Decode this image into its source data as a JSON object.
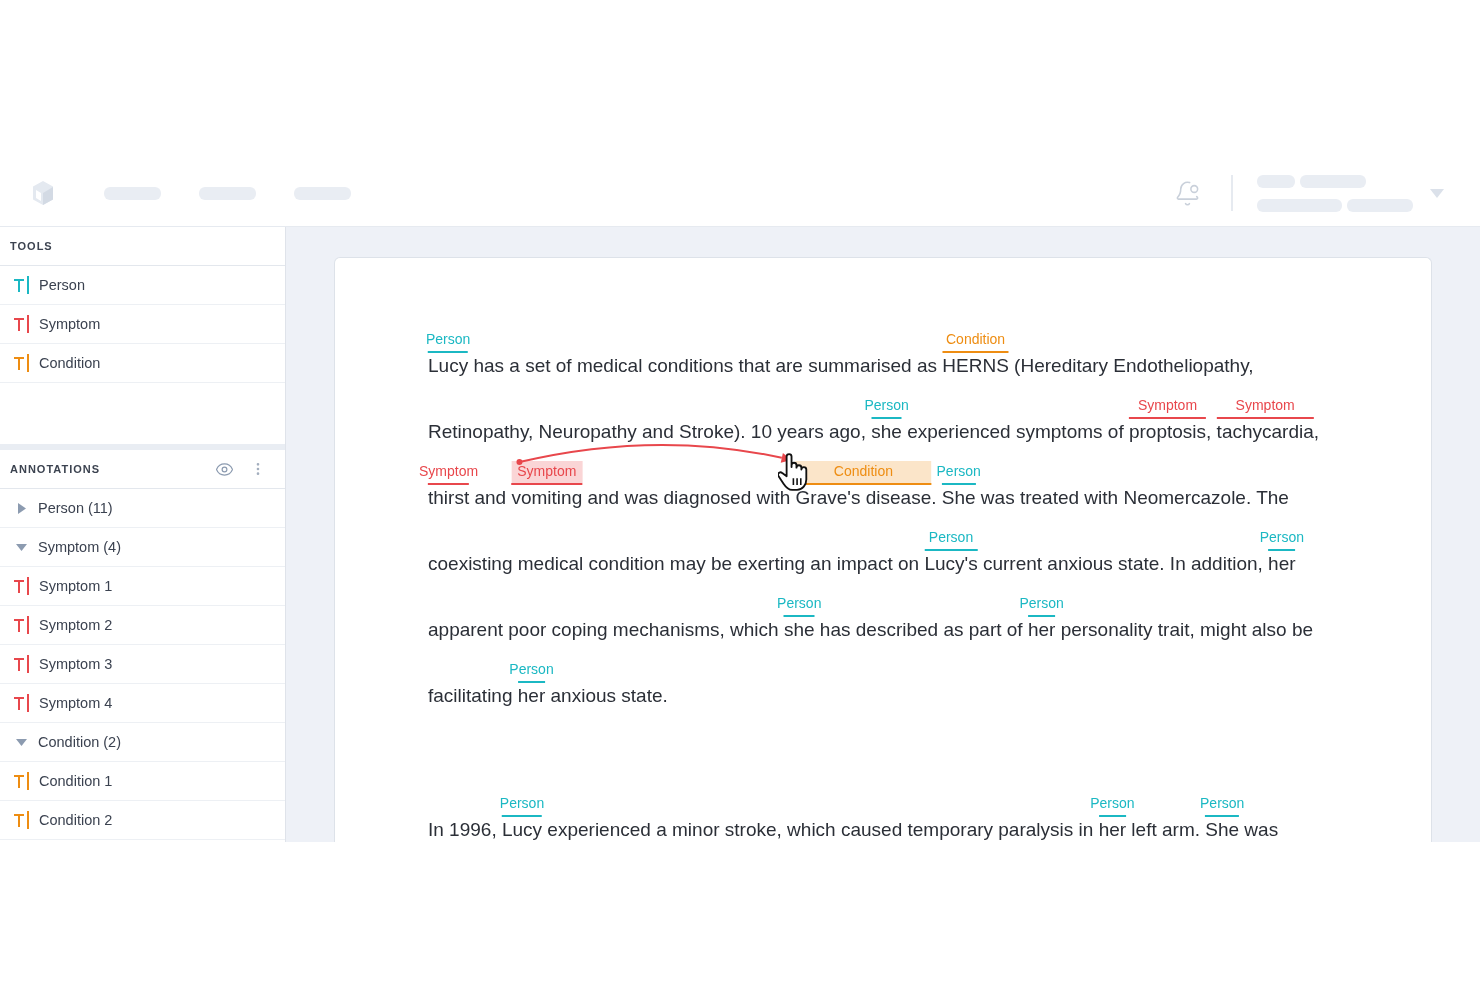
{
  "sidebar": {
    "tools": {
      "title": "TOOLS",
      "items": [
        {
          "label": "Person",
          "color": "#1bb8c3"
        },
        {
          "label": "Symptom",
          "color": "#e8474c"
        },
        {
          "label": "Condition",
          "color": "#ee8d12"
        }
      ]
    },
    "annotations": {
      "title": "ANNOTATIONS",
      "groups": [
        {
          "label": "Person (11)",
          "expanded": false
        },
        {
          "label": "Symptom (4)",
          "expanded": true,
          "children": [
            {
              "label": "Symptom 1",
              "color": "#e8474c"
            },
            {
              "label": "Symptom 2",
              "color": "#e8474c"
            },
            {
              "label": "Symptom 3",
              "color": "#e8474c"
            },
            {
              "label": "Symptom 4",
              "color": "#e8474c"
            }
          ]
        },
        {
          "label": "Condition (2)",
          "expanded": true,
          "children": [
            {
              "label": "Condition 1",
              "color": "#ee8d12"
            },
            {
              "label": "Condition 2",
              "color": "#ee8d12"
            }
          ]
        }
      ]
    }
  },
  "document": {
    "paragraphs": [
      {
        "lines": [
          {
            "segments": [
              {
                "text": "Lucy",
                "annotation": {
                  "label": "Person",
                  "color": "#1bb8c3",
                  "selected": false
                }
              },
              {
                "text": " has a set of medical conditions that are summarised as "
              },
              {
                "text": "HERNS",
                "annotation": {
                  "label": "Condition",
                  "color": "#ee8d12",
                  "selected": false
                }
              },
              {
                "text": " (Hereditary Endotheliopathy,"
              }
            ]
          },
          {
            "segments": [
              {
                "text": "Retinopathy, Neuropathy and Stroke). 10 years ago, "
              },
              {
                "text": "she",
                "annotation": {
                  "label": "Person",
                  "color": "#1bb8c3",
                  "selected": false
                }
              },
              {
                "text": " experienced symptoms of "
              },
              {
                "text": "proptosis",
                "annotation": {
                  "label": "Symptom",
                  "color": "#e8474c",
                  "selected": false
                }
              },
              {
                "text": ", "
              },
              {
                "text": "tachycardia",
                "annotation": {
                  "label": "Symptom",
                  "color": "#e8474c",
                  "selected": false
                }
              },
              {
                "text": ","
              }
            ]
          },
          {
            "segments": [
              {
                "text": "thirst",
                "annotation": {
                  "label": "Symptom",
                  "color": "#e8474c",
                  "selected": false
                }
              },
              {
                "text": " and "
              },
              {
                "text": "vomiting",
                "annotation": {
                  "label": "Symptom",
                  "color": "#e8474c",
                  "selected": true
                }
              },
              {
                "text": " and was diagnosed with "
              },
              {
                "text": "Grave's disease",
                "annotation": {
                  "label": "Condition",
                  "color": "#ee8d12",
                  "selected": true
                }
              },
              {
                "text": ". "
              },
              {
                "text": "She",
                "annotation": {
                  "label": "Person",
                  "color": "#1bb8c3",
                  "selected": false
                }
              },
              {
                "text": " was treated with Neomercazole. The"
              }
            ]
          },
          {
            "segments": [
              {
                "text": "coexisting medical condition may be exerting an impact on "
              },
              {
                "text": "Lucy's",
                "annotation": {
                  "label": "Person",
                  "color": "#1bb8c3",
                  "selected": false
                }
              },
              {
                "text": " current anxious state. In addition, "
              },
              {
                "text": "her",
                "annotation": {
                  "label": "Person",
                  "color": "#1bb8c3",
                  "selected": false
                }
              }
            ]
          },
          {
            "segments": [
              {
                "text": "apparent poor coping mechanisms, which "
              },
              {
                "text": "she",
                "annotation": {
                  "label": "Person",
                  "color": "#1bb8c3",
                  "selected": false
                }
              },
              {
                "text": " has described as part of "
              },
              {
                "text": "her",
                "annotation": {
                  "label": "Person",
                  "color": "#1bb8c3",
                  "selected": false
                }
              },
              {
                "text": " personality trait, might also be"
              }
            ]
          },
          {
            "segments": [
              {
                "text": "facilitating "
              },
              {
                "text": "her",
                "annotation": {
                  "label": "Person",
                  "color": "#1bb8c3",
                  "selected": false
                }
              },
              {
                "text": " anxious state."
              }
            ]
          }
        ]
      },
      {
        "lines": [
          {
            "segments": [
              {
                "text": "In 1996, "
              },
              {
                "text": "Lucy",
                "annotation": {
                  "label": "Person",
                  "color": "#1bb8c3",
                  "selected": false
                }
              },
              {
                "text": " experienced a minor stroke, which caused temporary paralysis in "
              },
              {
                "text": "her",
                "annotation": {
                  "label": "Person",
                  "color": "#1bb8c3",
                  "selected": false
                }
              },
              {
                "text": " left arm. "
              },
              {
                "text": "She",
                "annotation": {
                  "label": "Person",
                  "color": "#1bb8c3",
                  "selected": false
                }
              },
              {
                "text": " was"
              }
            ]
          }
        ]
      }
    ]
  }
}
